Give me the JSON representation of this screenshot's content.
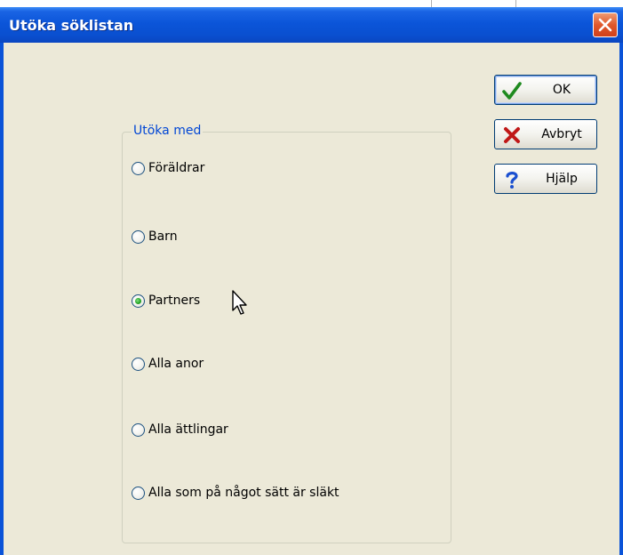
{
  "dialog": {
    "title": "Utöka söklistan"
  },
  "group": {
    "legend": "Utöka med",
    "options": [
      {
        "label": "Föräldrar",
        "checked": false
      },
      {
        "label": "Barn",
        "checked": false
      },
      {
        "label": "Partners",
        "checked": true
      },
      {
        "label": "Alla anor",
        "checked": false
      },
      {
        "label": "Alla ättlingar",
        "checked": false
      },
      {
        "label": "Alla som på något sätt är släkt",
        "checked": false
      }
    ]
  },
  "buttons": {
    "ok": {
      "label": "OK",
      "icon": "checkmark-icon",
      "color": "#1e8a1e"
    },
    "cancel": {
      "label": "Avbryt",
      "icon": "red-x-icon",
      "color": "#c01818"
    },
    "help": {
      "label": "Hjälp",
      "icon": "question-mark-icon",
      "color": "#1a4fd0"
    }
  },
  "colors": {
    "titlebar": "#0b55d9",
    "client": "#ece9d8",
    "legend": "#0046d5"
  }
}
